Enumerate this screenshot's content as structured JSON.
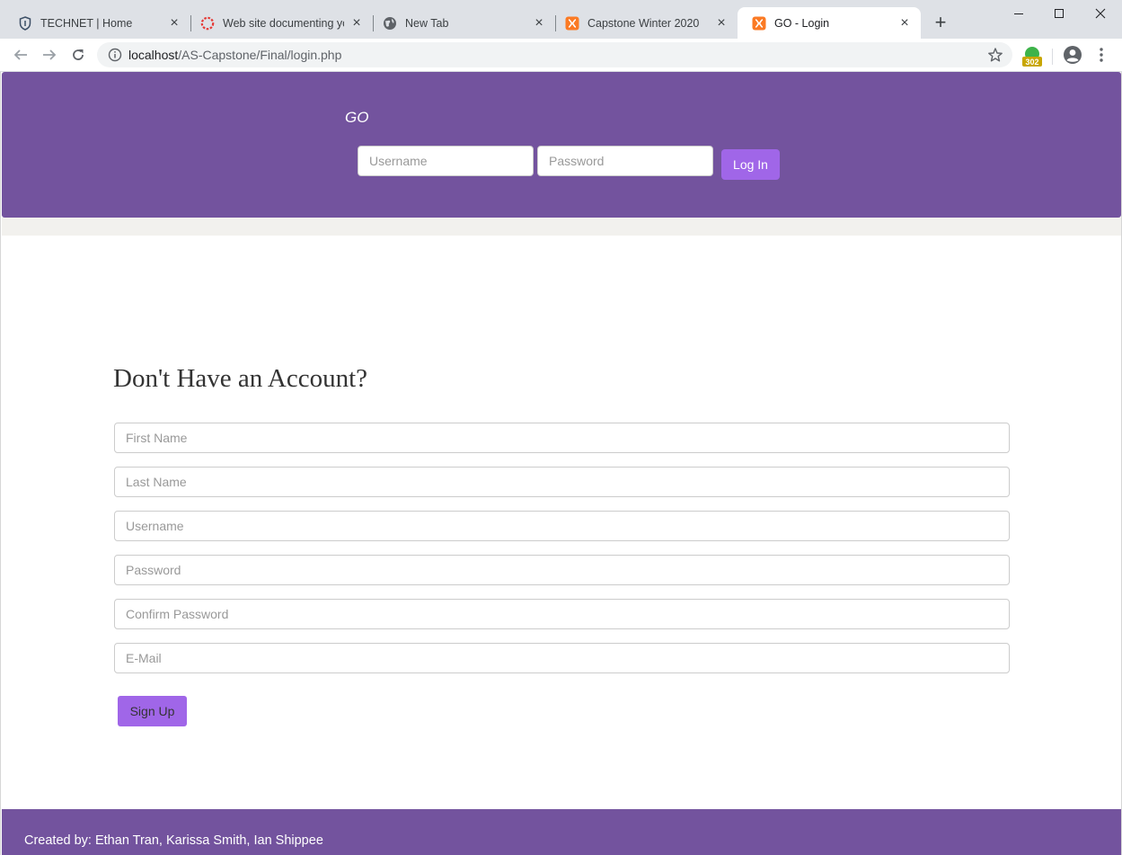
{
  "browser": {
    "tabs": [
      {
        "title": "TECHNET | Home",
        "icon": "shield-icon"
      },
      {
        "title": "Web site documenting yo",
        "icon": "dotted-circle-icon"
      },
      {
        "title": "New Tab",
        "icon": "globe-icon"
      },
      {
        "title": "Capstone Winter 2020",
        "icon": "xampp-icon"
      },
      {
        "title": "GO - Login",
        "icon": "xampp-icon",
        "active": true
      }
    ],
    "url_host": "localhost",
    "url_path": "/AS-Capstone/Final/login.php",
    "extension_badge": "302"
  },
  "header": {
    "brand": "GO",
    "username_placeholder": "Username",
    "password_placeholder": "Password",
    "login_label": "Log In"
  },
  "signup": {
    "title": "Don't Have an Account?",
    "first_name_placeholder": "First Name",
    "last_name_placeholder": "Last Name",
    "username_placeholder": "Username",
    "password_placeholder": "Password",
    "confirm_password_placeholder": "Confirm Password",
    "email_placeholder": "E-Mail",
    "signup_label": "Sign Up"
  },
  "footer": {
    "credits": "Created by: Ethan Tran, Karissa Smith, Ian Shippee"
  },
  "colors": {
    "brand_purple": "#73539e",
    "button_purple": "#a066e8",
    "strip": "#f2f1ee"
  }
}
